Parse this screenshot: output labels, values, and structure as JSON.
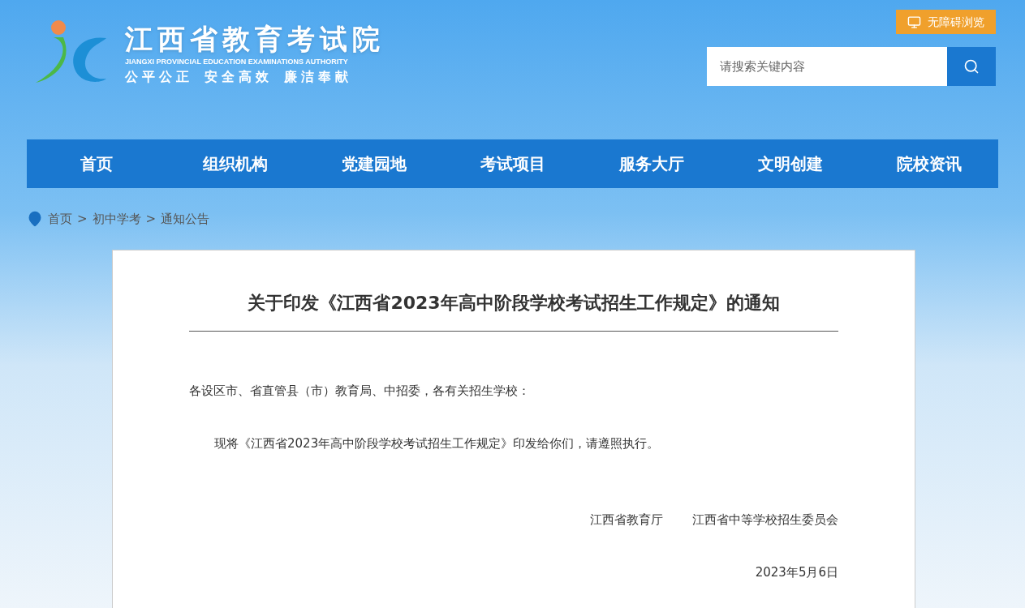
{
  "header": {
    "logo_title": "江西省教育考试院",
    "logo_subtitle": "JIANGXI PROVINCIAL EDUCATION EXAMINATIONS AUTHORITY",
    "logo_motto": [
      "公平公正",
      "安全高效",
      "廉洁奉献"
    ],
    "accessibility_button": "无障碍浏览",
    "search": {
      "placeholder": "请搜索关键内容"
    }
  },
  "nav": [
    {
      "label": "首页"
    },
    {
      "label": "组织机构"
    },
    {
      "label": "党建园地"
    },
    {
      "label": "考试项目"
    },
    {
      "label": "服务大厅"
    },
    {
      "label": "文明创建"
    },
    {
      "label": "院校资讯"
    }
  ],
  "breadcrumb": {
    "separator": ">",
    "items": [
      "首页",
      "初中学考",
      "通知公告"
    ]
  },
  "article": {
    "title": "关于印发《江西省2023年高中阶段学校考试招生工作规定》的通知",
    "salutation": "各设区市、省直管县（市）教育局、中招委，各有关招生学校：",
    "body": "现将《江西省2023年高中阶段学校考试招生工作规定》印发给你们，请遵照执行。",
    "signatories": [
      "江西省教育厅",
      "江西省中等学校招生委员会"
    ],
    "date": "2023年5月6日"
  }
}
